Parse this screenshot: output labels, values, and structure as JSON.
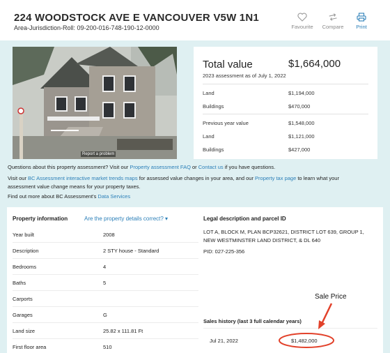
{
  "header": {
    "address": "224 WOODSTOCK AVE E VANCOUVER V5W 1N1",
    "roll": "Area-Jurisdiction-Roll: 09-200-016-748-190-12-0000",
    "actions": {
      "favourite": "Favourite",
      "compare": "Compare",
      "print": "Print"
    }
  },
  "icons": {
    "favourite": "heart-icon",
    "compare": "compare-arrows-icon",
    "print": "printer-icon"
  },
  "photo": {
    "report_link": "Report a problem"
  },
  "valuation": {
    "total_label": "Total value",
    "total_amount": "$1,664,000",
    "assessment_note": "2023 assessment as of July 1, 2022",
    "current": [
      {
        "label": "Land",
        "value": "$1,194,000"
      },
      {
        "label": "Buildings",
        "value": "$470,000"
      }
    ],
    "previous_label": "Previous year value",
    "previous_total": "$1,548,000",
    "previous": [
      {
        "label": "Land",
        "value": "$1,121,000"
      },
      {
        "label": "Buildings",
        "value": "$427,000"
      }
    ]
  },
  "info": {
    "p1_pre": "Questions about this property assessment? Visit our ",
    "p1_link1": "Property assessment FAQ",
    "p1_mid": " or ",
    "p1_link2": "Contact us",
    "p1_post": " if you have questions.",
    "p2_pre": "Visit our ",
    "p2_link1": "BC Assessment interactive market trends maps",
    "p2_mid": " for assessed value changes in your area, and our ",
    "p2_link2": "Property tax page",
    "p2_post": " to learn what your",
    "p2_line2": "assessment value change means for your property taxes.",
    "p3_pre": "Find out more about BC Assessment's ",
    "p3_link": "Data Services"
  },
  "property": {
    "title": "Property information",
    "correct_link": "Are the property details correct? ▾",
    "rows": [
      {
        "label": "Year built",
        "value": "2008"
      },
      {
        "label": "Description",
        "value": "2 STY house - Standard"
      },
      {
        "label": "Bedrooms",
        "value": "4"
      },
      {
        "label": "Baths",
        "value": "5"
      },
      {
        "label": "Carports",
        "value": ""
      },
      {
        "label": "Garages",
        "value": "G"
      },
      {
        "label": "Land size",
        "value": "25.82 x 111.81 Ft"
      },
      {
        "label": "First floor area",
        "value": "510"
      }
    ]
  },
  "legal": {
    "title": "Legal description and parcel ID",
    "text": "LOT A, BLOCK M, PLAN BCP32621, DISTRICT LOT 639, GROUP 1, NEW WESTMINSTER LAND DISTRICT, & DL 640",
    "pid": "PID: 027-225-356"
  },
  "sales": {
    "title": "Sales history (last 3 full calendar years)",
    "rows": [
      {
        "date": "Jul 21, 2022",
        "price": "$1,482,000"
      }
    ]
  },
  "annotation": {
    "text": "Sale Price",
    "color": "#e2412a"
  },
  "colors": {
    "link": "#2b7fb8",
    "background": "#dff0f2"
  }
}
